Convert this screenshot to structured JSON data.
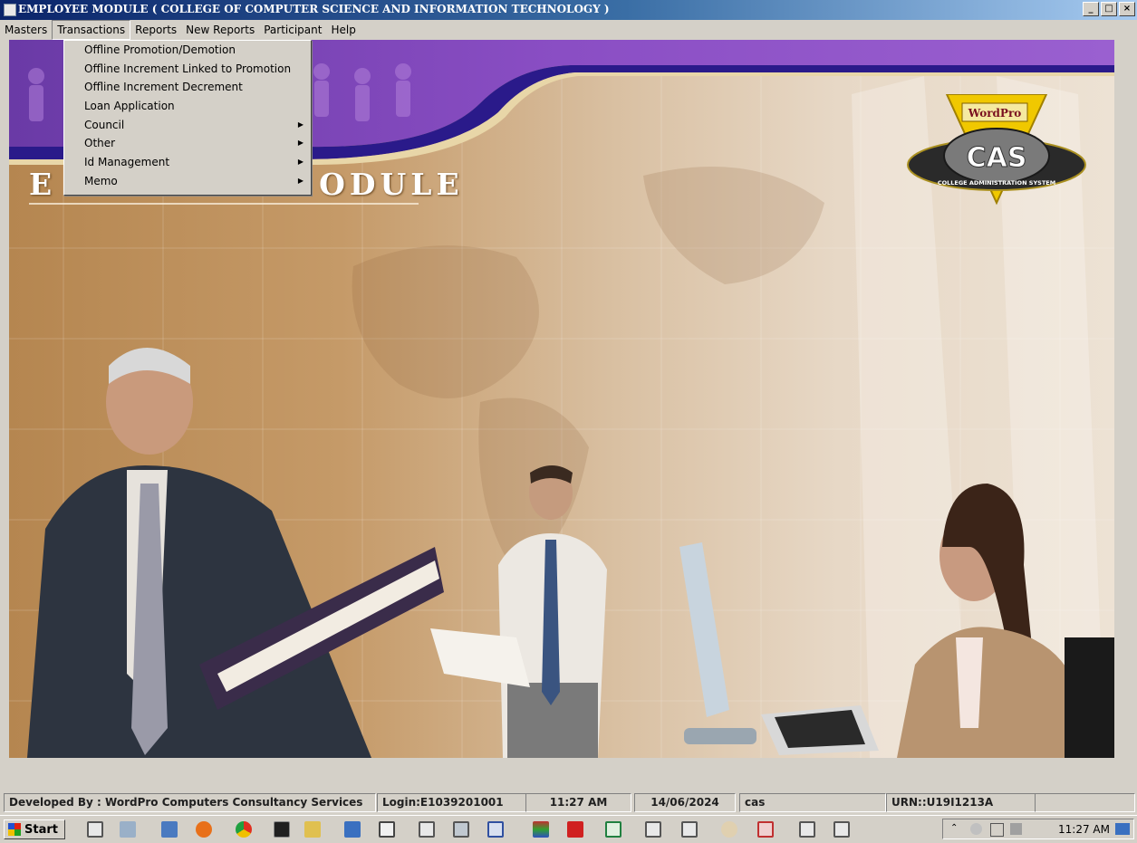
{
  "window": {
    "title": "EMPLOYEE MODULE  ( COLLEGE OF COMPUTER SCIENCE AND INFORMATION TECHNOLOGY )",
    "buttons": [
      "_",
      "□",
      "×"
    ]
  },
  "menubar": {
    "items": [
      "Masters",
      "Transactions",
      "Reports",
      "New Reports",
      "Participant",
      "Help"
    ],
    "active": "Transactions"
  },
  "dropdown": {
    "items": [
      {
        "label": "Offline Promotion/Demotion",
        "submenu": false
      },
      {
        "label": "Offline Increment Linked to Promotion",
        "submenu": false
      },
      {
        "label": "Offline Increment Decrement",
        "submenu": false
      },
      {
        "label": "Loan Application",
        "submenu": false
      },
      {
        "label": "Council",
        "submenu": true
      },
      {
        "label": "Other",
        "submenu": true
      },
      {
        "label": "Id Management",
        "submenu": true
      },
      {
        "label": "Memo",
        "submenu": true
      }
    ],
    "submenu_arrow": "▶"
  },
  "canvas": {
    "module_title_visible": "ODULE",
    "module_title_left_fragment": "E",
    "logo": {
      "brand_top": "WordPro",
      "brand_main": "CAS",
      "ring_text": "COLLEGE ADMINISTRATION SYSTEM"
    }
  },
  "statusbar": {
    "developer": "Developed By : WordPro Computers Consultancy Services",
    "login": "Login:E1039201001",
    "time": "11:27 AM",
    "date": "14/06/2024",
    "user": "cas",
    "urn": "URN::U19I1213A"
  },
  "taskbar": {
    "start_label": "Start",
    "clock": "11:27 AM"
  },
  "colors": {
    "titlebar_start": "#0a246a",
    "banner_purple": "#5a2a9a",
    "accent_gold": "#f0c800"
  }
}
